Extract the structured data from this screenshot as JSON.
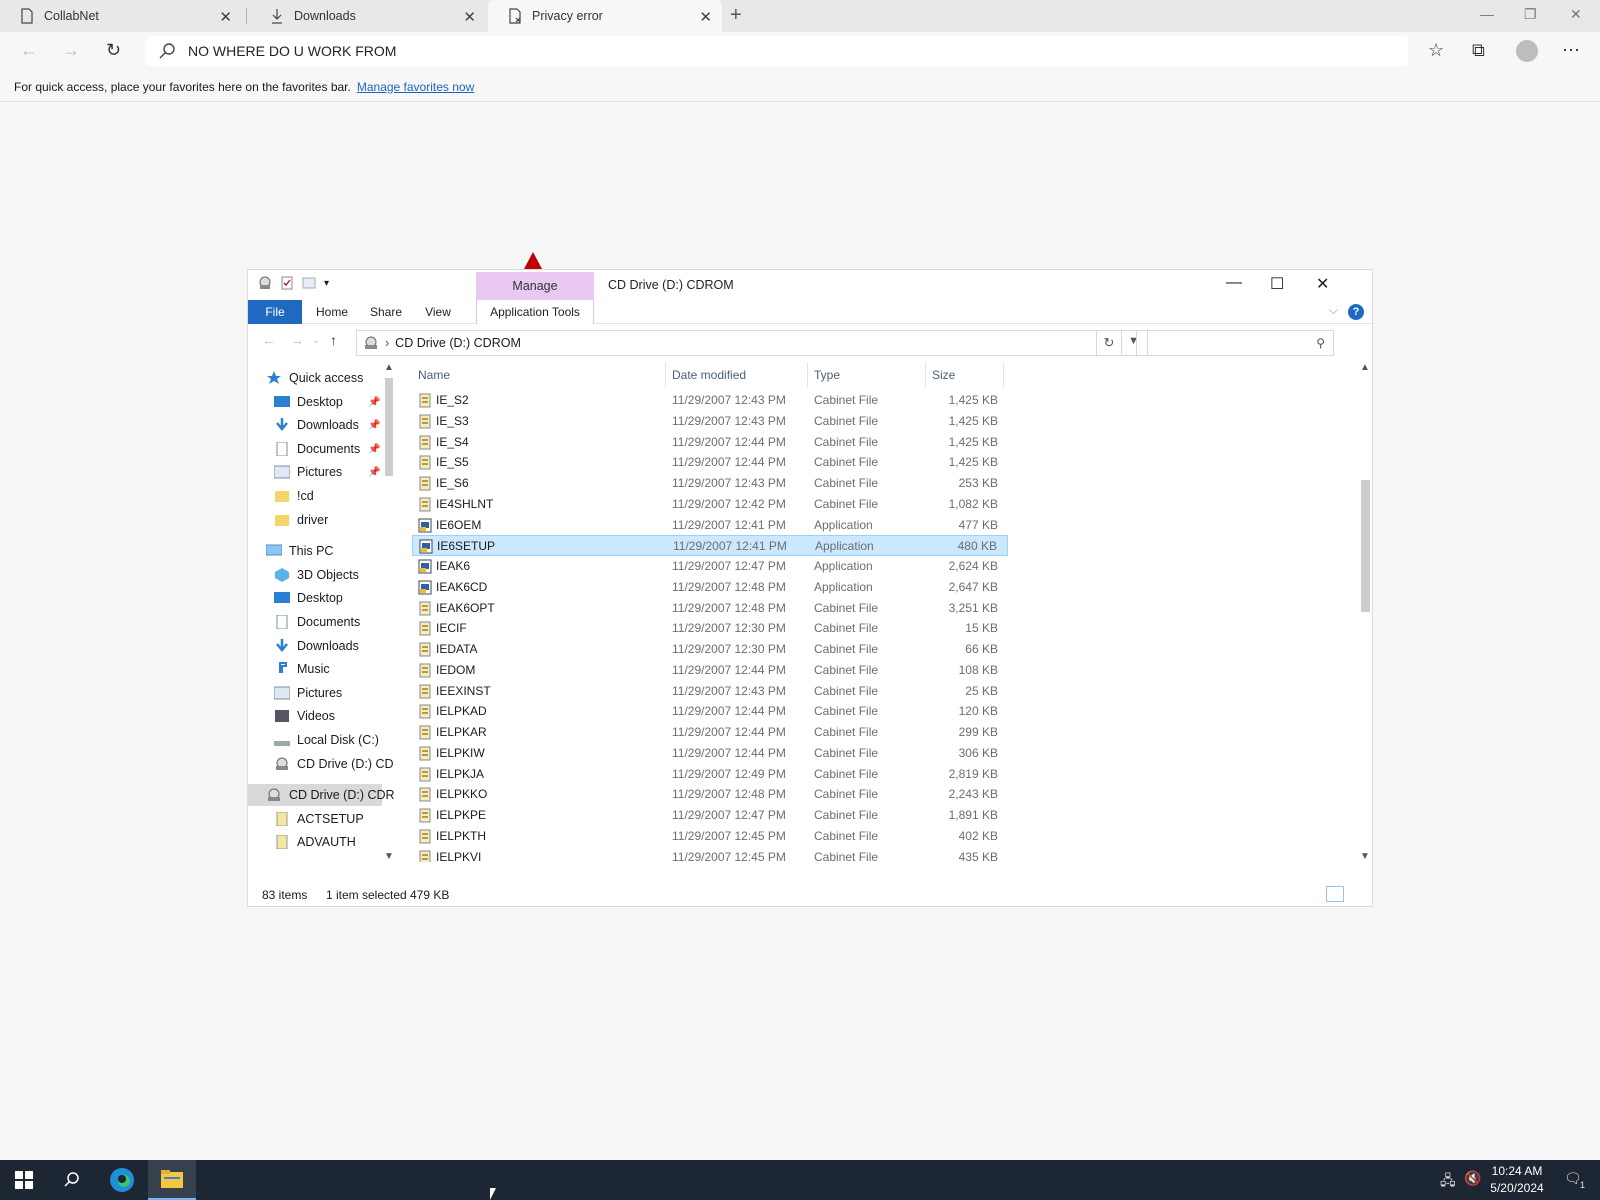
{
  "browser": {
    "tabs": [
      {
        "title": "CollabNet",
        "icon": "page-icon",
        "active": false
      },
      {
        "title": "Downloads",
        "icon": "download-icon",
        "active": false
      },
      {
        "title": "Privacy error",
        "icon": "page-error-icon",
        "active": true
      }
    ],
    "address": "NO WHERE DO U WORK FROM",
    "favorites_message": "For quick access, place your favorites here on the favorites bar.",
    "favorites_link": "Manage favorites now"
  },
  "explorer": {
    "title": "CD Drive (D:) CDROM",
    "manage_tab": "Manage",
    "ribbon_tabs": [
      "File",
      "Home",
      "Share",
      "View",
      "Application Tools"
    ],
    "path": "CD Drive (D:) CDROM",
    "columns": [
      "Name",
      "Date modified",
      "Type",
      "Size"
    ],
    "nav": [
      {
        "label": "Quick access",
        "icon": "star-icon",
        "indent": 0
      },
      {
        "label": "Desktop",
        "icon": "desktop-icon",
        "indent": 1,
        "pinned": true
      },
      {
        "label": "Downloads",
        "icon": "download-arrow-icon",
        "indent": 1,
        "pinned": true
      },
      {
        "label": "Documents",
        "icon": "documents-icon",
        "indent": 1,
        "pinned": true
      },
      {
        "label": "Pictures",
        "icon": "pictures-icon",
        "indent": 1,
        "pinned": true
      },
      {
        "label": "!cd",
        "icon": "folder-icon",
        "indent": 1
      },
      {
        "label": "driver",
        "icon": "folder-icon",
        "indent": 1
      },
      {
        "label": "This PC",
        "icon": "computer-icon",
        "indent": 0
      },
      {
        "label": "3D Objects",
        "icon": "cube-icon",
        "indent": 1
      },
      {
        "label": "Desktop",
        "icon": "desktop-icon",
        "indent": 1
      },
      {
        "label": "Documents",
        "icon": "documents-icon",
        "indent": 1
      },
      {
        "label": "Downloads",
        "icon": "download-arrow-icon",
        "indent": 1
      },
      {
        "label": "Music",
        "icon": "music-icon",
        "indent": 1
      },
      {
        "label": "Pictures",
        "icon": "pictures-icon",
        "indent": 1
      },
      {
        "label": "Videos",
        "icon": "videos-icon",
        "indent": 1
      },
      {
        "label": "Local Disk (C:)",
        "icon": "disk-icon",
        "indent": 1
      },
      {
        "label": "CD Drive (D:) CD",
        "icon": "cd-drive-icon",
        "indent": 1
      },
      {
        "label": "CD Drive (D:) CDR",
        "icon": "cd-drive-icon",
        "indent": 0,
        "selected": true
      },
      {
        "label": "ACTSETUP",
        "icon": "cabinet-file-icon",
        "indent": 1
      },
      {
        "label": "ADVAUTH",
        "icon": "cabinet-file-icon",
        "indent": 1
      }
    ],
    "files": [
      {
        "name": "IE_S2",
        "date": "11/29/2007 12:43 PM",
        "type": "Cabinet File",
        "size": "1,425 KB"
      },
      {
        "name": "IE_S3",
        "date": "11/29/2007 12:43 PM",
        "type": "Cabinet File",
        "size": "1,425 KB"
      },
      {
        "name": "IE_S4",
        "date": "11/29/2007 12:44 PM",
        "type": "Cabinet File",
        "size": "1,425 KB"
      },
      {
        "name": "IE_S5",
        "date": "11/29/2007 12:44 PM",
        "type": "Cabinet File",
        "size": "1,425 KB"
      },
      {
        "name": "IE_S6",
        "date": "11/29/2007 12:43 PM",
        "type": "Cabinet File",
        "size": "253 KB"
      },
      {
        "name": "IE4SHLNT",
        "date": "11/29/2007 12:42 PM",
        "type": "Cabinet File",
        "size": "1,082 KB"
      },
      {
        "name": "IE6OEM",
        "date": "11/29/2007 12:41 PM",
        "type": "Application",
        "size": "477 KB"
      },
      {
        "name": "IE6SETUP",
        "date": "11/29/2007 12:41 PM",
        "type": "Application",
        "size": "480 KB",
        "selected": true
      },
      {
        "name": "IEAK6",
        "date": "11/29/2007 12:47 PM",
        "type": "Application",
        "size": "2,624 KB"
      },
      {
        "name": "IEAK6CD",
        "date": "11/29/2007 12:48 PM",
        "type": "Application",
        "size": "2,647 KB"
      },
      {
        "name": "IEAK6OPT",
        "date": "11/29/2007 12:48 PM",
        "type": "Cabinet File",
        "size": "3,251 KB"
      },
      {
        "name": "IECIF",
        "date": "11/29/2007 12:30 PM",
        "type": "Cabinet File",
        "size": "15 KB"
      },
      {
        "name": "IEDATA",
        "date": "11/29/2007 12:30 PM",
        "type": "Cabinet File",
        "size": "66 KB"
      },
      {
        "name": "IEDOM",
        "date": "11/29/2007 12:44 PM",
        "type": "Cabinet File",
        "size": "108 KB"
      },
      {
        "name": "IEEXINST",
        "date": "11/29/2007 12:43 PM",
        "type": "Cabinet File",
        "size": "25 KB"
      },
      {
        "name": "IELPKAD",
        "date": "11/29/2007 12:44 PM",
        "type": "Cabinet File",
        "size": "120 KB"
      },
      {
        "name": "IELPKAR",
        "date": "11/29/2007 12:44 PM",
        "type": "Cabinet File",
        "size": "299 KB"
      },
      {
        "name": "IELPKIW",
        "date": "11/29/2007 12:44 PM",
        "type": "Cabinet File",
        "size": "306 KB"
      },
      {
        "name": "IELPKJA",
        "date": "11/29/2007 12:49 PM",
        "type": "Cabinet File",
        "size": "2,819 KB"
      },
      {
        "name": "IELPKKO",
        "date": "11/29/2007 12:48 PM",
        "type": "Cabinet File",
        "size": "2,243 KB"
      },
      {
        "name": "IELPKPE",
        "date": "11/29/2007 12:47 PM",
        "type": "Cabinet File",
        "size": "1,891 KB"
      },
      {
        "name": "IELPKTH",
        "date": "11/29/2007 12:45 PM",
        "type": "Cabinet File",
        "size": "402 KB"
      },
      {
        "name": "IELPKVI",
        "date": "11/29/2007 12:45 PM",
        "type": "Cabinet File",
        "size": "435 KB"
      }
    ],
    "status": {
      "count": "83 items",
      "selected": "1 item selected",
      "size": "479 KB"
    }
  },
  "taskbar": {
    "time": "10:24 AM",
    "date": "5/20/2024",
    "notification_count": "1"
  },
  "colors": {
    "file_tab": "#1f6ac0",
    "manage_tab": "#e9c9f2",
    "selection": "#cce8ff",
    "taskbar": "#1d2633"
  }
}
